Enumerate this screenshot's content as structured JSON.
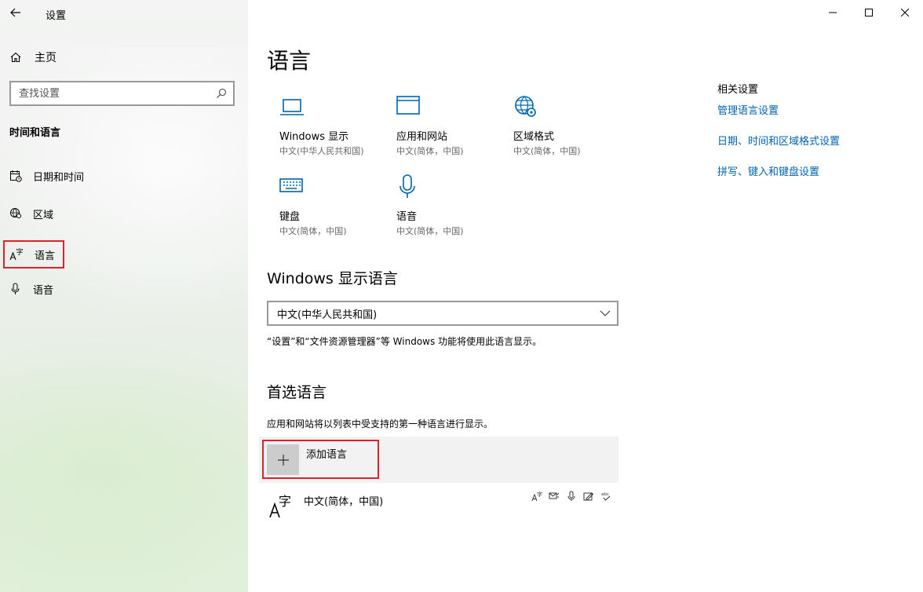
{
  "window": {
    "title": "设置"
  },
  "sidebar": {
    "home_label": "主页",
    "search_placeholder": "查找设置",
    "section_title": "时间和语言",
    "items": [
      {
        "label": "日期和时间",
        "icon": "calendar-clock-icon"
      },
      {
        "label": "区域",
        "icon": "globe-pin-icon"
      },
      {
        "label": "语言",
        "icon": "language-icon",
        "selected": true
      },
      {
        "label": "语音",
        "icon": "microphone-icon"
      }
    ]
  },
  "main": {
    "title": "语言",
    "tiles": [
      {
        "label": "Windows 显示",
        "sub": "中文(中华人民共和国)",
        "icon": "laptop-icon"
      },
      {
        "label": "应用和网站",
        "sub": "中文(简体，中国)",
        "icon": "browser-window-icon"
      },
      {
        "label": "区域格式",
        "sub": "中文(简体，中国)",
        "icon": "globe-settings-icon"
      },
      {
        "label": "键盘",
        "sub": "中文(简体，中国)",
        "icon": "keyboard-icon"
      },
      {
        "label": "语音",
        "sub": "中文(简体，中国)",
        "icon": "microphone-icon"
      }
    ],
    "display_language": {
      "heading": "Windows 显示语言",
      "selected": "中文(中华人民共和国)",
      "description": "“设置”和“文件资源管理器”等 Windows 功能将使用此语言显示。"
    },
    "preferred": {
      "heading": "首选语言",
      "description": "应用和网站将以列表中受支持的第一种语言进行显示。",
      "add_label": "添加语言",
      "languages": [
        {
          "name": "中文(简体，中国)",
          "features": [
            "display-language-icon",
            "text-to-speech-icon",
            "speech-recognition-icon",
            "handwriting-icon",
            "spellcheck-icon"
          ]
        }
      ]
    }
  },
  "related": {
    "title": "相关设置",
    "links": [
      "管理语言设置",
      "日期、时间和区域格式设置",
      "拼写、键入和键盘设置"
    ]
  },
  "colors": {
    "accent": "#0063b1",
    "highlight": "#e0212b",
    "sidebar_bg": "#eef0ee"
  }
}
